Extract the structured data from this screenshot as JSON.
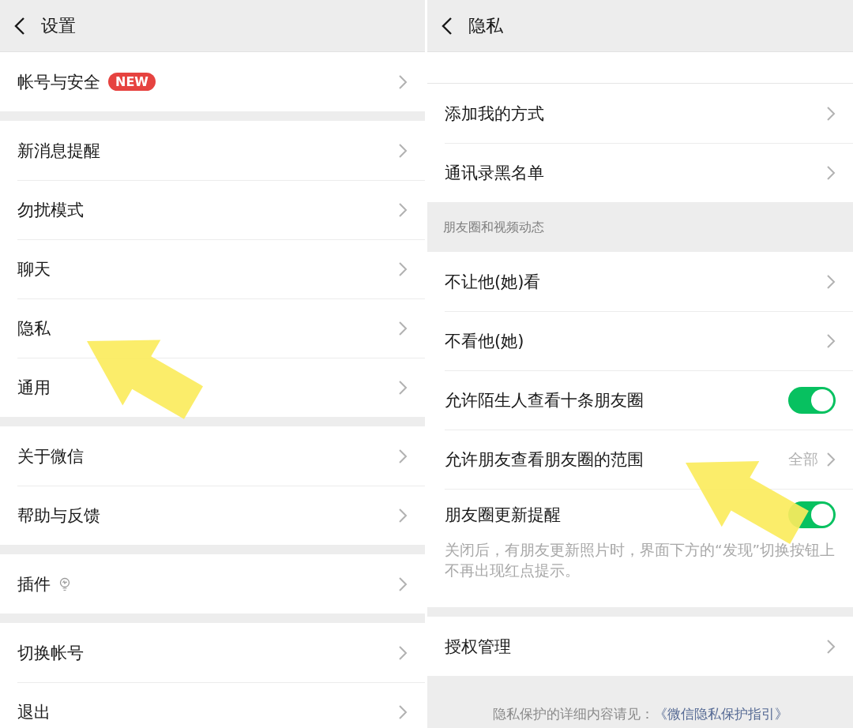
{
  "panels": [
    {
      "title": "设置",
      "sections": [
        {
          "items": [
            {
              "kind": "link",
              "label": "帐号与安全",
              "badge": "NEW"
            }
          ]
        },
        {
          "items": [
            {
              "kind": "link",
              "label": "新消息提醒"
            },
            {
              "kind": "link",
              "label": "勿扰模式"
            },
            {
              "kind": "link",
              "label": "聊天"
            },
            {
              "kind": "link",
              "label": "隐私"
            },
            {
              "kind": "link",
              "label": "通用"
            }
          ]
        },
        {
          "items": [
            {
              "kind": "link",
              "label": "关于微信"
            },
            {
              "kind": "link",
              "label": "帮助与反馈"
            }
          ]
        },
        {
          "items": [
            {
              "kind": "link",
              "label": "插件",
              "trailing_icon": true
            }
          ]
        },
        {
          "items": [
            {
              "kind": "link",
              "label": "切换帐号"
            },
            {
              "kind": "link",
              "label": "退出"
            }
          ]
        }
      ]
    },
    {
      "title": "隐私",
      "sections": [
        {
          "items": [
            {
              "kind": "link",
              "label": "添加我的方式"
            },
            {
              "kind": "link",
              "label": "通讯录黑名单"
            }
          ]
        },
        {
          "header": "朋友圈和视频动态",
          "items": [
            {
              "kind": "link",
              "label": "不让他(她)看"
            },
            {
              "kind": "link",
              "label": "不看他(她)"
            },
            {
              "kind": "toggle",
              "label": "允许陌生人查看十条朋友圈",
              "on": true
            },
            {
              "kind": "link",
              "label": "允许朋友查看朋友圈的范围",
              "value": "全部"
            },
            {
              "kind": "toggle",
              "label": "朋友圈更新提醒",
              "on": true,
              "note": "关闭后，有朋友更新照片时，界面下方的“发现”切换按钮上不再出现红点提示。"
            }
          ]
        },
        {
          "items": [
            {
              "kind": "link",
              "label": "授权管理"
            }
          ]
        }
      ],
      "footer": {
        "text": "隐私保护的详细内容请见：",
        "link": "《微信隐私保护指引》"
      }
    }
  ]
}
